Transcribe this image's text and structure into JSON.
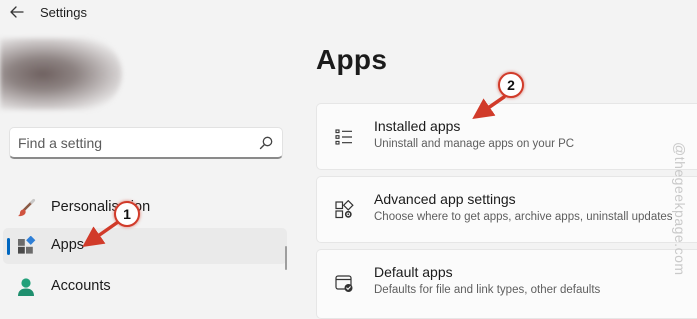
{
  "window": {
    "title": "Settings"
  },
  "search": {
    "placeholder": "Find a setting"
  },
  "sidebar": {
    "items": [
      {
        "label": "Personalisation",
        "icon": "paintbrush-icon"
      },
      {
        "label": "Apps",
        "icon": "apps-icon",
        "selected": true
      },
      {
        "label": "Accounts",
        "icon": "person-icon"
      }
    ]
  },
  "main": {
    "title": "Apps",
    "cards": [
      {
        "title": "Installed apps",
        "subtitle": "Uninstall and manage apps on your PC",
        "icon": "list-icon"
      },
      {
        "title": "Advanced app settings",
        "subtitle": "Choose where to get apps, archive apps, uninstall updates",
        "icon": "app-gear-icon"
      },
      {
        "title": "Default apps",
        "subtitle": "Defaults for file and link types, other defaults",
        "icon": "default-app-icon"
      }
    ]
  },
  "annotations": {
    "badge1": "1",
    "badge2": "2",
    "color": "#d13b2a"
  },
  "watermark": "@thegeekpage.com",
  "colors": {
    "accent": "#0067c0",
    "background": "#f3f3f3",
    "card": "#fbfbfb"
  }
}
